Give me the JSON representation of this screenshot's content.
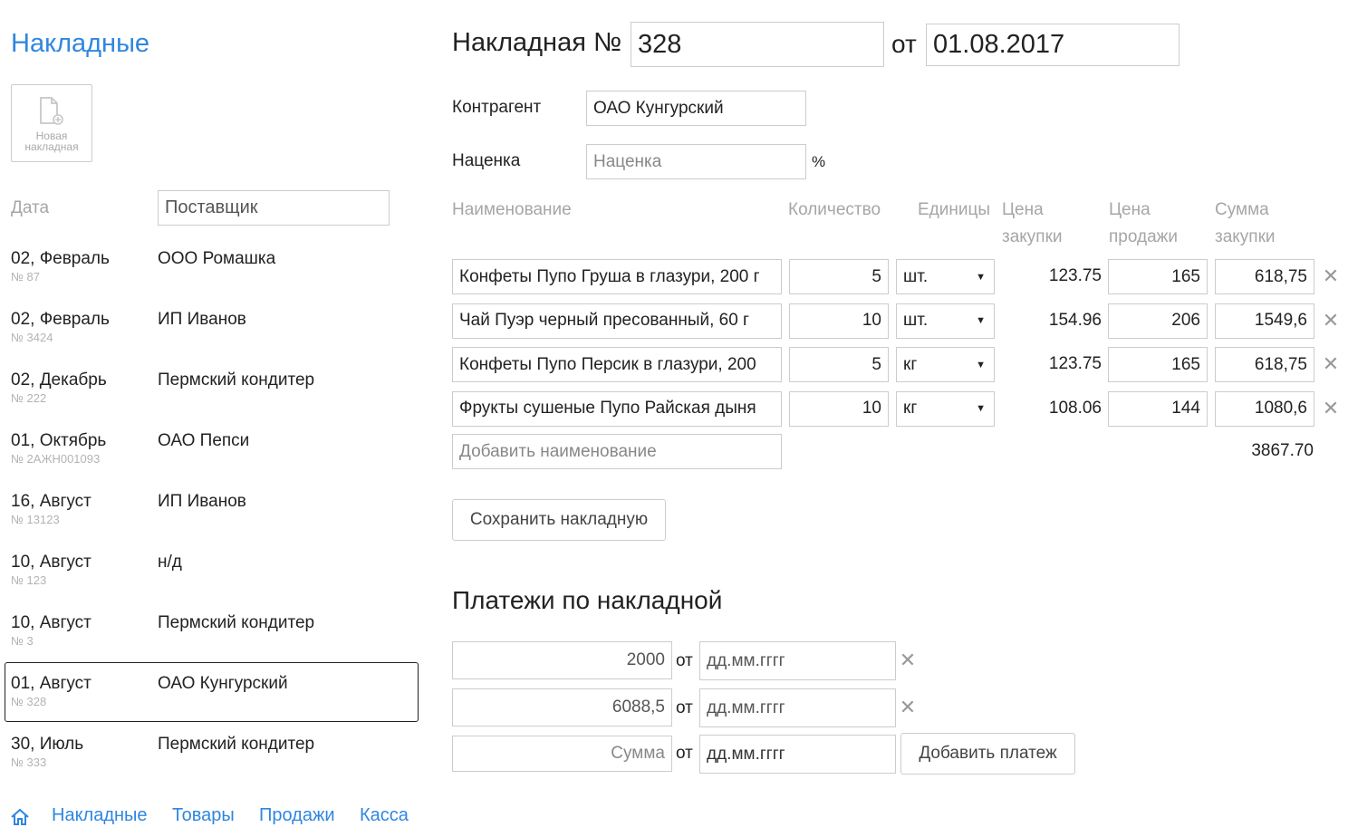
{
  "sidebar": {
    "title": "Накладные",
    "new_button_label_line1": "Новая",
    "new_button_label_line2": "накладная",
    "filter_date_label": "Дата",
    "filter_supplier_placeholder": "Поставщик",
    "invoices": [
      {
        "date": "02, Февраль",
        "number": "№ 87",
        "supplier": "ООО Ромашка"
      },
      {
        "date": "02, Февраль",
        "number": "№ 3424",
        "supplier": "ИП Иванов"
      },
      {
        "date": "02, Декабрь",
        "number": "№ 222",
        "supplier": "Пермский кондитер"
      },
      {
        "date": "01, Октябрь",
        "number": "№ 2АЖН001093",
        "supplier": "ОАО Пепси"
      },
      {
        "date": "16, Август",
        "number": "№ 13123",
        "supplier": "ИП Иванов"
      },
      {
        "date": "10, Август",
        "number": "№ 123",
        "supplier": "н/д"
      },
      {
        "date": "10, Август",
        "number": "№ 3",
        "supplier": "Пермский кондитер"
      },
      {
        "date": "01, Август",
        "number": "№ 328",
        "supplier": "ОАО Кунгурский"
      },
      {
        "date": "30, Июль",
        "number": "№ 333",
        "supplier": "Пермский кондитер"
      }
    ],
    "selected_index": 7
  },
  "nav": {
    "home_icon": "home-icon",
    "items": [
      "Накладные",
      "Товары",
      "Продажи",
      "Касса"
    ],
    "color": "#2f86e0"
  },
  "invoice": {
    "heading": "Накладная №",
    "number": "328",
    "date_label": "от",
    "date": "01.08.2017",
    "counterparty_label": "Контрагент",
    "counterparty": "ОАО Кунгурский",
    "markup_label": "Наценка",
    "markup_placeholder": "Наценка",
    "markup_unit": "%",
    "columns": {
      "name": "Наименование",
      "qty": "Количество",
      "unit": "Единицы",
      "buy_price_1": "Цена",
      "buy_price_2": "закупки",
      "sell_price_1": "Цена",
      "sell_price_2": "продажи",
      "sum_1": "Сумма",
      "sum_2": "закупки"
    },
    "items": [
      {
        "name": "Конфеты Пупо Груша в глазури, 200 г",
        "qty": "5",
        "unit": "шт.",
        "buy_price": "123.75",
        "sell_price": "165",
        "sum": "618,75"
      },
      {
        "name": "Чай Пуэр черный пресованный, 60 г",
        "qty": "10",
        "unit": "шт.",
        "buy_price": "154.96",
        "sell_price": "206",
        "sum": "1549,6"
      },
      {
        "name": "Конфеты Пупо Персик в глазури, 200",
        "qty": "5",
        "unit": "кг",
        "buy_price": "123.75",
        "sell_price": "165",
        "sum": "618,75"
      },
      {
        "name": "Фрукты сушеные Пупо Райская дыня",
        "qty": "10",
        "unit": "кг",
        "buy_price": "108.06",
        "sell_price": "144",
        "sum": "1080,6"
      }
    ],
    "add_item_placeholder": "Добавить наименование",
    "total": "3867.70",
    "save_button": "Сохранить накладную"
  },
  "payments": {
    "heading": "Платежи по накладной",
    "date_label": "от",
    "date_placeholder": "дд.мм.гггг",
    "list": [
      {
        "amount": "2000"
      },
      {
        "amount": "6088,5"
      }
    ],
    "new_amount_placeholder": "Сумма",
    "add_button": "Добавить платеж"
  }
}
